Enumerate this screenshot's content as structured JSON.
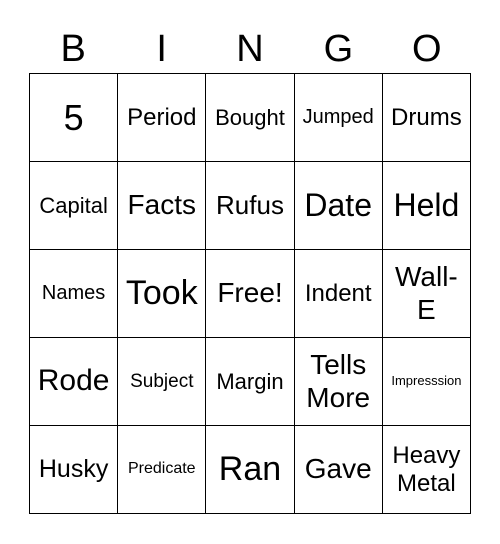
{
  "header": [
    "B",
    "I",
    "N",
    "G",
    "O"
  ],
  "cells": [
    {
      "text": "5",
      "size": 36
    },
    {
      "text": "Period",
      "size": 24
    },
    {
      "text": "Bought",
      "size": 22
    },
    {
      "text": "Jumped",
      "size": 20
    },
    {
      "text": "Drums",
      "size": 24
    },
    {
      "text": "Capital",
      "size": 22
    },
    {
      "text": "Facts",
      "size": 28
    },
    {
      "text": "Rufus",
      "size": 26
    },
    {
      "text": "Date",
      "size": 32
    },
    {
      "text": "Held",
      "size": 32
    },
    {
      "text": "Names",
      "size": 20
    },
    {
      "text": "Took",
      "size": 34
    },
    {
      "text": "Free!",
      "size": 28
    },
    {
      "text": "Indent",
      "size": 24
    },
    {
      "text": "Wall-\nE",
      "size": 28
    },
    {
      "text": "Rode",
      "size": 30
    },
    {
      "text": "Subject",
      "size": 19
    },
    {
      "text": "Margin",
      "size": 22
    },
    {
      "text": "Tells\nMore",
      "size": 28
    },
    {
      "text": "Impresssion",
      "size": 13
    },
    {
      "text": "Husky",
      "size": 25
    },
    {
      "text": "Predicate",
      "size": 16
    },
    {
      "text": "Ran",
      "size": 34
    },
    {
      "text": "Gave",
      "size": 28
    },
    {
      "text": "Heavy\nMetal",
      "size": 24
    }
  ]
}
